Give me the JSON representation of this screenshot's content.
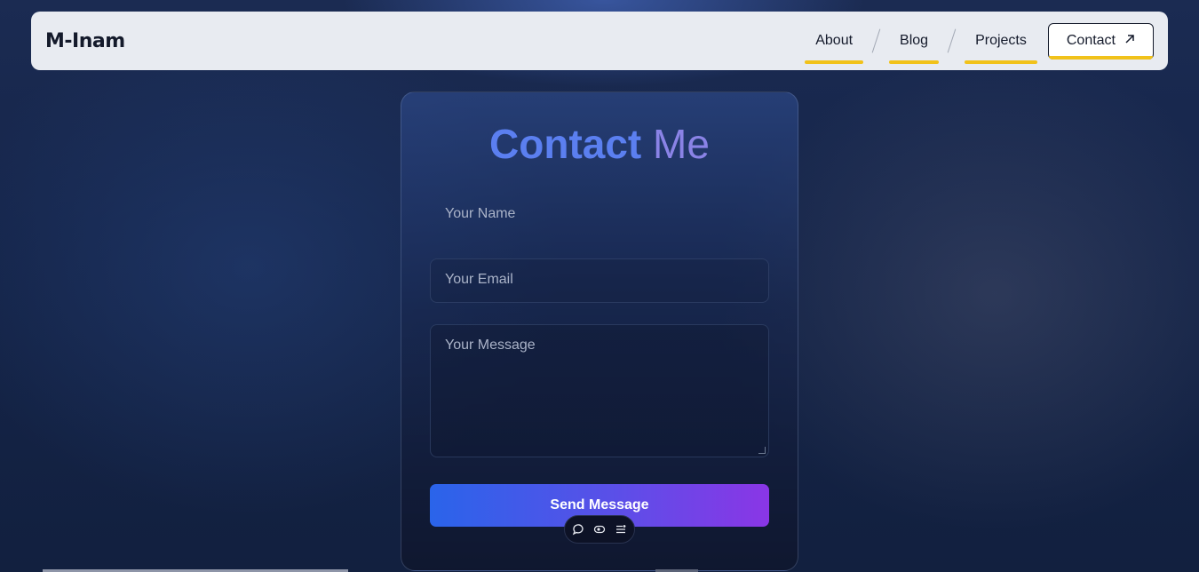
{
  "brand": "M-Inam",
  "nav": {
    "items": [
      {
        "label": "About"
      },
      {
        "label": "Blog"
      },
      {
        "label": "Projects"
      }
    ],
    "contact_label": "Contact",
    "contact_icon": "arrow-up-right-icon"
  },
  "form": {
    "title_bold": "Contact",
    "title_light": "Me",
    "name_placeholder": "Your Name",
    "email_placeholder": "Your Email",
    "message_placeholder": "Your Message",
    "submit_label": "Send Message"
  },
  "toolbar": {
    "icons": [
      "comment-icon",
      "eye-icon",
      "settings-list-icon"
    ]
  },
  "colors": {
    "accent_underline": "#f1c21b",
    "title_blue": "#5b7ff0",
    "title_purple": "#8a83e6",
    "button_gradient_start": "#2a64ea",
    "button_gradient_end": "#8a36e6"
  }
}
